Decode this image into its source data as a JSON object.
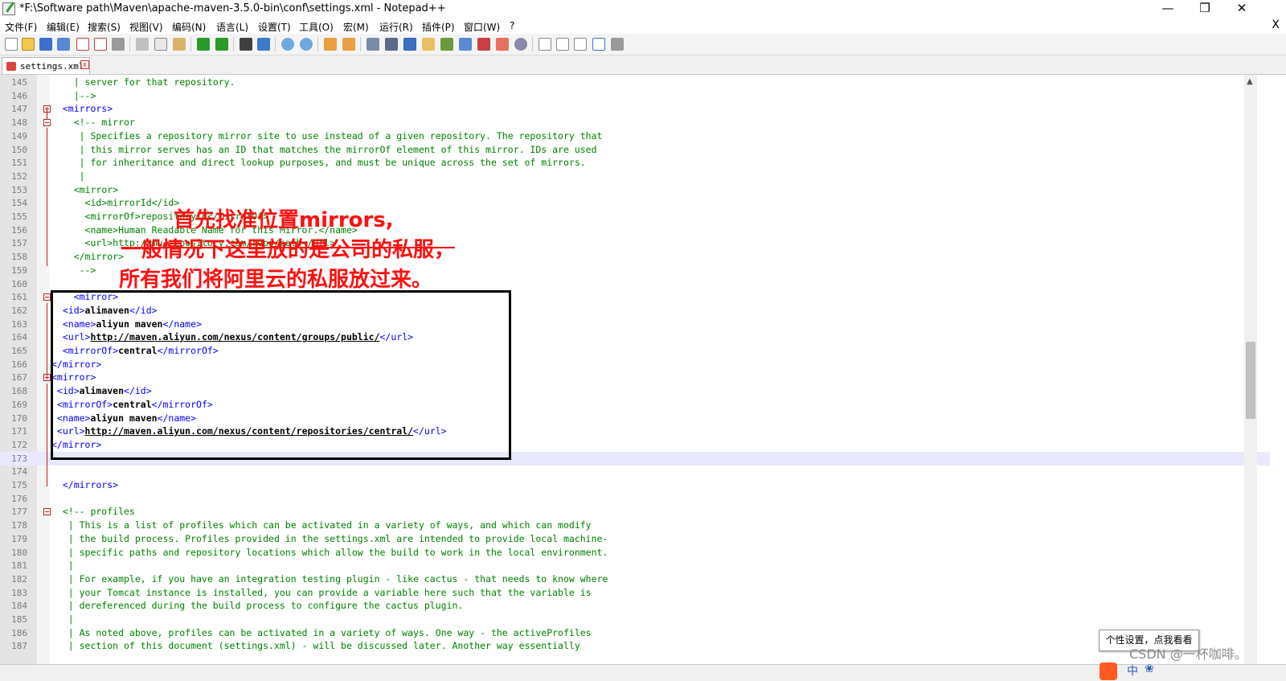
{
  "window": {
    "title": "*F:\\Software path\\Maven\\apache-maven-3.5.0-bin\\conf\\settings.xml - Notepad++",
    "minimize": "—",
    "restore": "❐",
    "close": "✕"
  },
  "menu": {
    "items": [
      "文件(F)",
      "编辑(E)",
      "搜索(S)",
      "视图(V)",
      "编码(N)",
      "语言(L)",
      "设置(T)",
      "工具(O)",
      "宏(M)",
      "运行(R)",
      "插件(P)",
      "窗口(W)",
      "?"
    ],
    "close_x": "X"
  },
  "tab": {
    "label": "settings.xml",
    "close": "x"
  },
  "editor": {
    "lines": [
      {
        "n": "145",
        "parts": [
          {
            "t": "    | server for that repository.",
            "c": "c-comment"
          }
        ]
      },
      {
        "n": "146",
        "parts": [
          {
            "t": "    |-->",
            "c": "c-comment"
          }
        ]
      },
      {
        "n": "147",
        "parts": [
          {
            "t": "  <mirrors>",
            "c": "c-tag"
          }
        ]
      },
      {
        "n": "148",
        "parts": [
          {
            "t": "    <!-- mirror",
            "c": "c-comment"
          }
        ]
      },
      {
        "n": "149",
        "parts": [
          {
            "t": "     | Specifies a repository mirror site to use instead of a given repository. The repository that",
            "c": "c-comment"
          }
        ]
      },
      {
        "n": "150",
        "parts": [
          {
            "t": "     | this mirror serves has an ID that matches the mirrorOf element of this mirror. IDs are used",
            "c": "c-comment"
          }
        ]
      },
      {
        "n": "151",
        "parts": [
          {
            "t": "     | for inheritance and direct lookup purposes, and must be unique across the set of mirrors.",
            "c": "c-comment"
          }
        ]
      },
      {
        "n": "152",
        "parts": [
          {
            "t": "     |",
            "c": "c-comment"
          }
        ]
      },
      {
        "n": "153",
        "parts": [
          {
            "t": "    <mirror>",
            "c": "c-comment"
          }
        ]
      },
      {
        "n": "154",
        "parts": [
          {
            "t": "      <id>mirrorId</id>",
            "c": "c-comment"
          }
        ]
      },
      {
        "n": "155",
        "parts": [
          {
            "t": "      <mirrorOf>repositoryId</mirrorOf>",
            "c": "c-comment"
          }
        ]
      },
      {
        "n": "156",
        "parts": [
          {
            "t": "      <name>Human Readable Name for this Mirror.</name>",
            "c": "c-comment"
          }
        ]
      },
      {
        "n": "157",
        "parts": [
          {
            "t": "      <url>http://my.repository.com/repo/path</url>",
            "c": "c-comment"
          }
        ]
      },
      {
        "n": "158",
        "parts": [
          {
            "t": "    </mirror>",
            "c": "c-comment"
          }
        ]
      },
      {
        "n": "159",
        "parts": [
          {
            "t": "     -->",
            "c": "c-comment"
          }
        ]
      },
      {
        "n": "160",
        "parts": [
          {
            "t": "",
            "c": "c-gray"
          }
        ]
      },
      {
        "n": "161",
        "parts": [
          {
            "t": "    <mirror>",
            "c": "c-tag"
          }
        ]
      },
      {
        "n": "162",
        "parts": [
          {
            "t": "  <id>",
            "c": "c-tag"
          },
          {
            "t": "alimaven",
            "c": "c-text"
          },
          {
            "t": "</id>",
            "c": "c-tag"
          }
        ]
      },
      {
        "n": "163",
        "parts": [
          {
            "t": "  <name>",
            "c": "c-tag"
          },
          {
            "t": "aliyun maven",
            "c": "c-text"
          },
          {
            "t": "</name>",
            "c": "c-tag"
          }
        ]
      },
      {
        "n": "164",
        "parts": [
          {
            "t": "  <url>",
            "c": "c-tag"
          },
          {
            "t": "http://maven.aliyun.com/nexus/content/groups/public/",
            "c": "c-url"
          },
          {
            "t": "</url>",
            "c": "c-tag"
          }
        ]
      },
      {
        "n": "165",
        "parts": [
          {
            "t": "  <mirrorOf>",
            "c": "c-tag"
          },
          {
            "t": "central",
            "c": "c-text"
          },
          {
            "t": "</mirrorOf>",
            "c": "c-tag"
          }
        ]
      },
      {
        "n": "166",
        "parts": [
          {
            "t": "</mirror>",
            "c": "c-tag"
          }
        ]
      },
      {
        "n": "167",
        "parts": [
          {
            "t": "<mirror>",
            "c": "c-tag"
          }
        ]
      },
      {
        "n": "168",
        "parts": [
          {
            "t": " <id>",
            "c": "c-tag"
          },
          {
            "t": "alimaven",
            "c": "c-text"
          },
          {
            "t": "</id>",
            "c": "c-tag"
          }
        ]
      },
      {
        "n": "169",
        "parts": [
          {
            "t": " <mirrorOf>",
            "c": "c-tag"
          },
          {
            "t": "central",
            "c": "c-text"
          },
          {
            "t": "</mirrorOf>",
            "c": "c-tag"
          }
        ]
      },
      {
        "n": "170",
        "parts": [
          {
            "t": " <name>",
            "c": "c-tag"
          },
          {
            "t": "aliyun maven",
            "c": "c-text"
          },
          {
            "t": "</name>",
            "c": "c-tag"
          }
        ]
      },
      {
        "n": "171",
        "parts": [
          {
            "t": " <url>",
            "c": "c-tag"
          },
          {
            "t": "http://maven.aliyun.com/nexus/content/repositories/central/",
            "c": "c-url"
          },
          {
            "t": "</url>",
            "c": "c-tag"
          }
        ]
      },
      {
        "n": "172",
        "parts": [
          {
            "t": "</mirror>",
            "c": "c-tag"
          }
        ]
      },
      {
        "n": "173",
        "parts": [
          {
            "t": "",
            "c": "c-gray"
          }
        ],
        "current": true
      },
      {
        "n": "174",
        "parts": [
          {
            "t": "",
            "c": "c-gray"
          }
        ]
      },
      {
        "n": "175",
        "parts": [
          {
            "t": "  </mirrors>",
            "c": "c-tag"
          }
        ]
      },
      {
        "n": "176",
        "parts": [
          {
            "t": "",
            "c": "c-gray"
          }
        ]
      },
      {
        "n": "177",
        "parts": [
          {
            "t": "  <!-- profiles",
            "c": "c-comment"
          }
        ]
      },
      {
        "n": "178",
        "parts": [
          {
            "t": "   | This is a list of profiles which can be activated in a variety of ways, and which can modify",
            "c": "c-comment"
          }
        ]
      },
      {
        "n": "179",
        "parts": [
          {
            "t": "   | the build process. Profiles provided in the settings.xml are intended to provide local machine-",
            "c": "c-comment"
          }
        ]
      },
      {
        "n": "180",
        "parts": [
          {
            "t": "   | specific paths and repository locations which allow the build to work in the local environment.",
            "c": "c-comment"
          }
        ]
      },
      {
        "n": "181",
        "parts": [
          {
            "t": "   |",
            "c": "c-comment"
          }
        ]
      },
      {
        "n": "182",
        "parts": [
          {
            "t": "   | For example, if you have an integration testing plugin - like cactus - that needs to know where",
            "c": "c-comment"
          }
        ]
      },
      {
        "n": "183",
        "parts": [
          {
            "t": "   | your Tomcat instance is installed, you can provide a variable here such that the variable is",
            "c": "c-comment"
          }
        ]
      },
      {
        "n": "184",
        "parts": [
          {
            "t": "   | dereferenced during the build process to configure the cactus plugin.",
            "c": "c-comment"
          }
        ]
      },
      {
        "n": "185",
        "parts": [
          {
            "t": "   |",
            "c": "c-comment"
          }
        ]
      },
      {
        "n": "186",
        "parts": [
          {
            "t": "   | As noted above, profiles can be activated in a variety of ways. One way - the activeProfiles",
            "c": "c-comment"
          }
        ]
      },
      {
        "n": "187",
        "parts": [
          {
            "t": "   | section of this document (settings.xml) - will be discussed later. Another way essentially",
            "c": "c-comment"
          }
        ]
      }
    ]
  },
  "annotation": {
    "line1": "首先找准位置mirrors,",
    "line2": "一般情况下这里放的是公司的私服，",
    "line3": "所有我们将阿里云的私服放过来。"
  },
  "tooltip": "个性设置，点我看看",
  "watermark": "CSDN @一杯咖啡。",
  "tray": {
    "ime": "中",
    "sym": "❀"
  },
  "colors": {
    "comment": "#008000",
    "tag": "#0000ff",
    "annotation": "#ff1010",
    "current_line": "#e8e8ff"
  }
}
